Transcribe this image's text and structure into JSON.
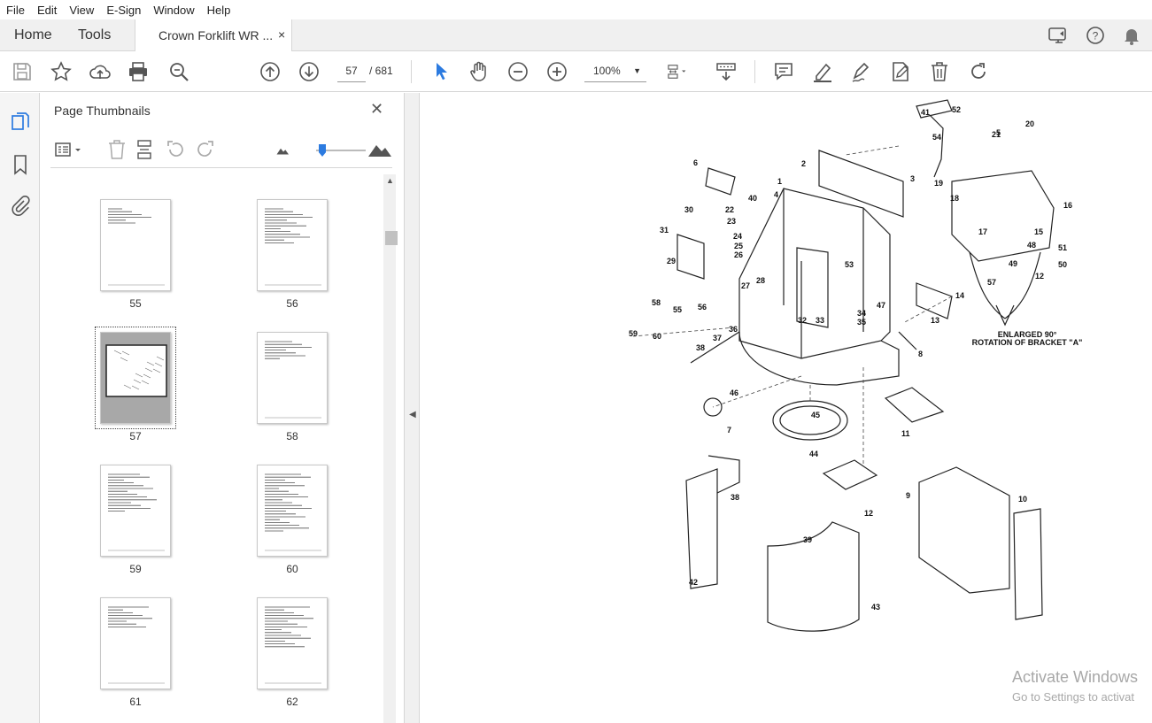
{
  "menu": [
    "File",
    "Edit",
    "View",
    "E-Sign",
    "Window",
    "Help"
  ],
  "tabs": {
    "home": "Home",
    "tools": "Tools",
    "doc_title": "Crown Forklift WR ...",
    "close": "×"
  },
  "toolbar": {
    "current_page": "57",
    "page_total": "/ 681",
    "zoom": "100%"
  },
  "icons": {
    "save": "save-icon",
    "bookmark": "star-icon",
    "upload": "upload-cloud-icon",
    "print": "print-icon",
    "find": "search-zoom-icon",
    "prev": "arrow-up-circle-icon",
    "next": "arrow-down-circle-icon",
    "select": "pointer-icon",
    "hand": "hand-icon",
    "zoom_out": "minus-circle-icon",
    "zoom_in": "plus-circle-icon"
  },
  "panel": {
    "title": "Page Thumbnails",
    "close": "✕",
    "thumbnails": [
      {
        "page": "55"
      },
      {
        "page": "56"
      },
      {
        "page": "57",
        "selected": true
      },
      {
        "page": "58"
      },
      {
        "page": "59"
      },
      {
        "page": "60"
      },
      {
        "page": "61"
      },
      {
        "page": "62"
      }
    ]
  },
  "drawing": {
    "callouts": [
      "41",
      "52",
      "54",
      "21",
      "5",
      "20",
      "2",
      "1",
      "4",
      "3",
      "6",
      "22",
      "23",
      "40",
      "19",
      "18",
      "16",
      "17",
      "15",
      "30",
      "31",
      "29",
      "24",
      "25",
      "26",
      "53",
      "48",
      "49",
      "51",
      "50",
      "12",
      "28",
      "27",
      "57",
      "14",
      "47",
      "13",
      "58",
      "56",
      "55",
      "34",
      "35",
      "32",
      "33",
      "59",
      "60",
      "38",
      "37",
      "36",
      "8",
      "46",
      "45",
      "11",
      "7",
      "44",
      "38",
      "42",
      "12",
      "9",
      "10",
      "39",
      "43"
    ],
    "note_line1": "ENLARGED 90°",
    "note_line2": "ROTATION OF BRACKET \"A\""
  },
  "watermark": {
    "line1": "Activate Windows",
    "line2": "Go to Settings to activat"
  },
  "colors": {
    "accent": "#2c7be0",
    "selected_thumb_bg": "#a8a8a8"
  }
}
